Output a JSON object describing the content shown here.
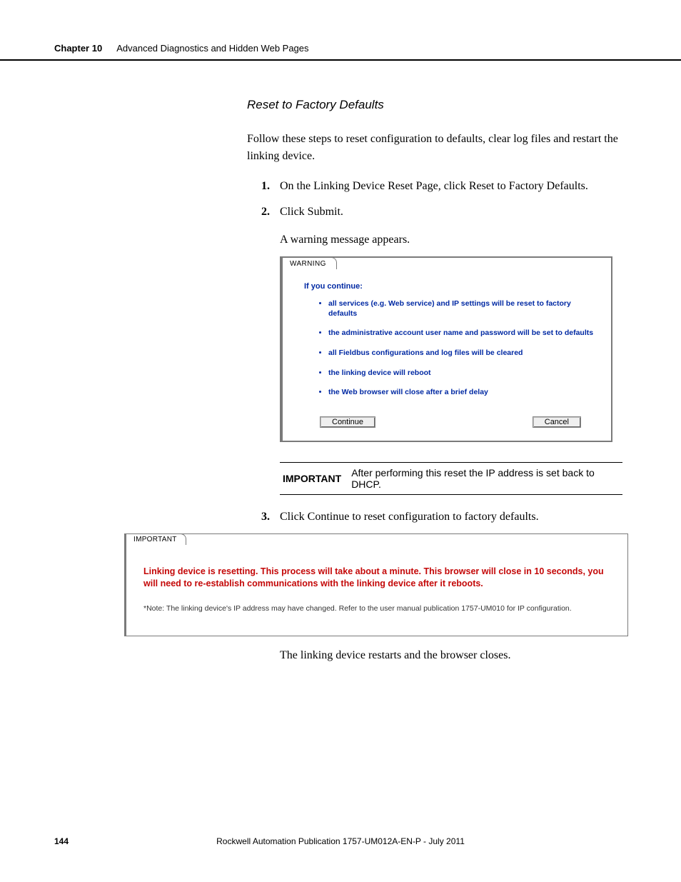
{
  "header": {
    "chapter_label": "Chapter 10",
    "chapter_title": "Advanced Diagnostics and Hidden Web Pages"
  },
  "section": {
    "title": "Reset to Factory Defaults",
    "intro": "Follow these steps to reset configuration to defaults, clear log files and restart the linking device.",
    "steps": {
      "s1": "On the Linking Device Reset Page, click Reset to Factory Defaults.",
      "s2": "Click Submit.",
      "s2_after": "A warning message appears.",
      "s3": "Click Continue to reset configuration to factory defaults."
    }
  },
  "warning_panel": {
    "tab": "WARNING",
    "heading": "If you continue:",
    "items": {
      "i1": "all services (e.g. Web service) and IP settings will be reset to factory defaults",
      "i2": "the administrative account user name and password will be set to defaults",
      "i3": "all Fieldbus configurations and log files will be cleared",
      "i4": "the linking device will reboot",
      "i5": "the Web browser will close after a brief delay"
    },
    "continue_label": "Continue",
    "cancel_label": "Cancel"
  },
  "important_callout": {
    "label": "IMPORTANT",
    "text": "After performing this reset the IP address is set back to DHCP."
  },
  "important_panel": {
    "tab": "IMPORTANT",
    "message": "Linking device is resetting. This process will take about a minute. This browser will close in 10 seconds, you will need to re-establish communications with the linking device after it reboots.",
    "note": "*Note: The linking device's IP address may have changed. Refer to the user manual publication 1757-UM010 for IP configuration."
  },
  "closing": "The linking device restarts and the browser closes.",
  "footer": {
    "page": "144",
    "publication": "Rockwell Automation Publication 1757-UM012A-EN-P - July 2011"
  }
}
